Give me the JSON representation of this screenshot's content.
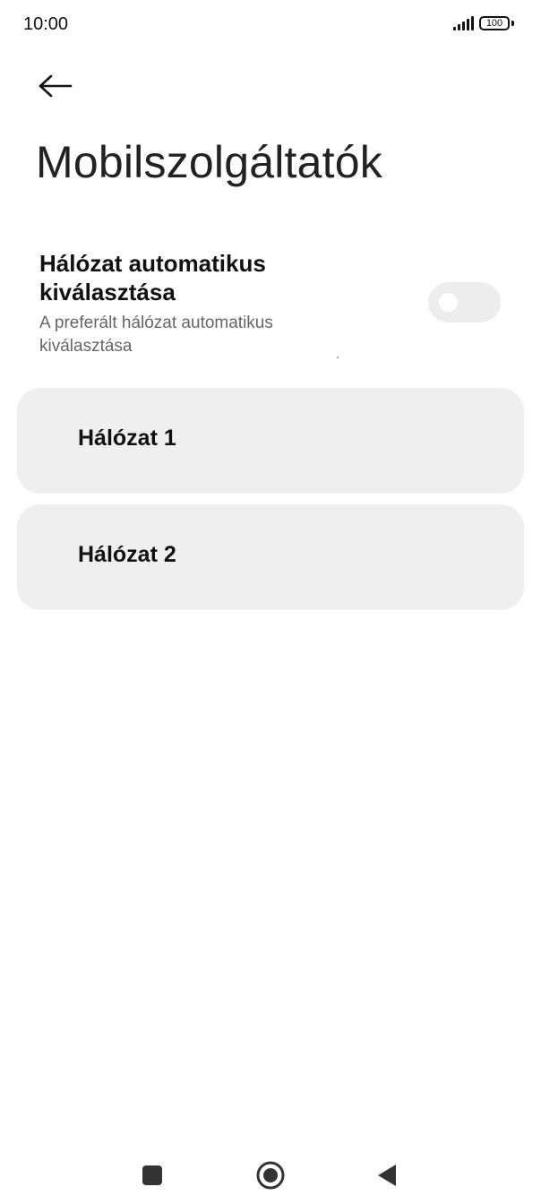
{
  "status_bar": {
    "time": "10:00",
    "battery": "100",
    "signal_icon": "signal-bars-icon",
    "battery_icon": "battery-icon"
  },
  "header": {
    "back_icon": "arrow-left-icon",
    "title": "Mobilszolgáltatók"
  },
  "auto_select": {
    "title": "Hálózat automatikus kiválasztása",
    "subtitle": "A preferált hálózat automatikus kiválasztása",
    "toggle_state": "off"
  },
  "networks": [
    {
      "label": "Hálózat 1"
    },
    {
      "label": "Hálózat 2"
    }
  ],
  "nav_bar": {
    "recents_icon": "square-icon",
    "home_icon": "circle-home-icon",
    "back_icon": "triangle-back-icon"
  },
  "colors": {
    "background": "#ffffff",
    "card": "#efefef",
    "toggle_track": "#ededed",
    "subtitle": "#666666"
  }
}
